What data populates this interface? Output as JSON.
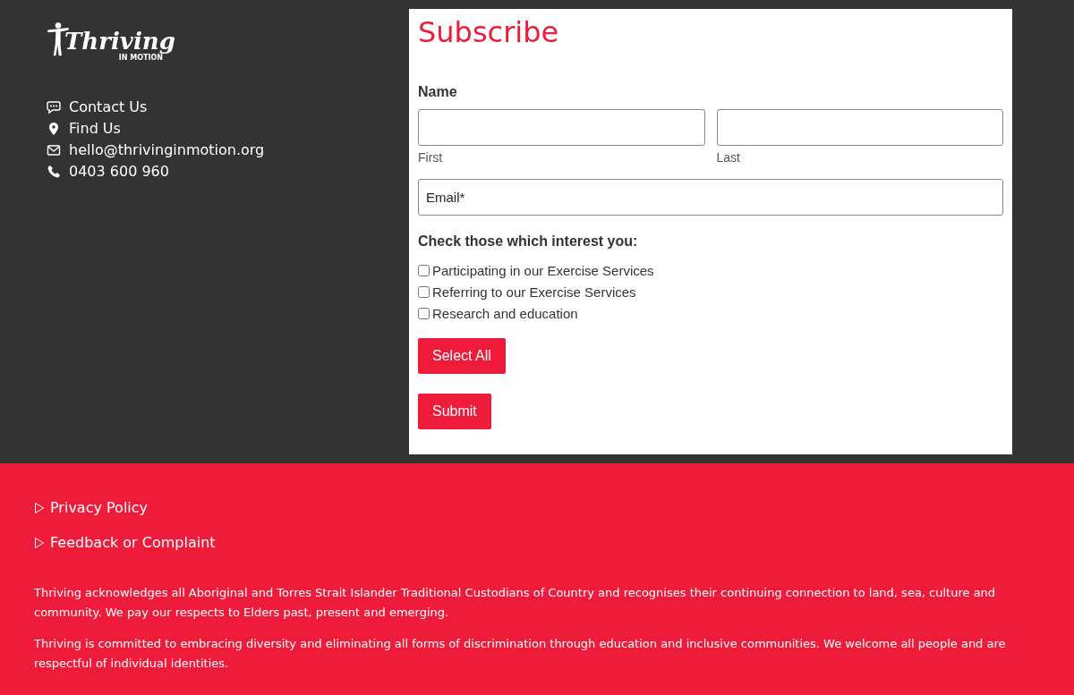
{
  "logo": {
    "name": "Thriving",
    "tagline": "IN MOTION"
  },
  "contact_links": [
    {
      "kind": "chat",
      "label": "Contact Us"
    },
    {
      "kind": "pin",
      "label": "Find Us"
    },
    {
      "kind": "mail",
      "label": "hello@thrivinginmotion.org"
    },
    {
      "kind": "phone",
      "label": "0403 600 960"
    }
  ],
  "subscribe_form": {
    "title": "Subscribe",
    "name_label": "Name",
    "first_caption": "First",
    "last_caption": "Last",
    "email": {
      "placeholder": "Email*"
    },
    "interests_label": "Check those which interest you:",
    "interests": [
      {
        "label": "Participating in our Exercise Services",
        "checked": false
      },
      {
        "label": "Referring to our Exercise Services",
        "checked": false
      },
      {
        "label": "Research and education",
        "checked": false
      }
    ],
    "select_all_button": "Select All",
    "submit_button": "Submit"
  },
  "footer": {
    "links": [
      "Privacy Policy",
      "Feedback or Complaint"
    ],
    "paragraphs": [
      "Thriving acknowledges all Aboriginal and Torres Strait Islander Traditional Custodians of Country and recognises their continuing connection to land, sea, culture and community. We pay our respects to Elders past, present and emerging.",
      "Thriving is committed to embracing diversity and eliminating all forms of discrimination through education and inclusive communities. We welcome all people and are respectful of individual identities."
    ]
  }
}
